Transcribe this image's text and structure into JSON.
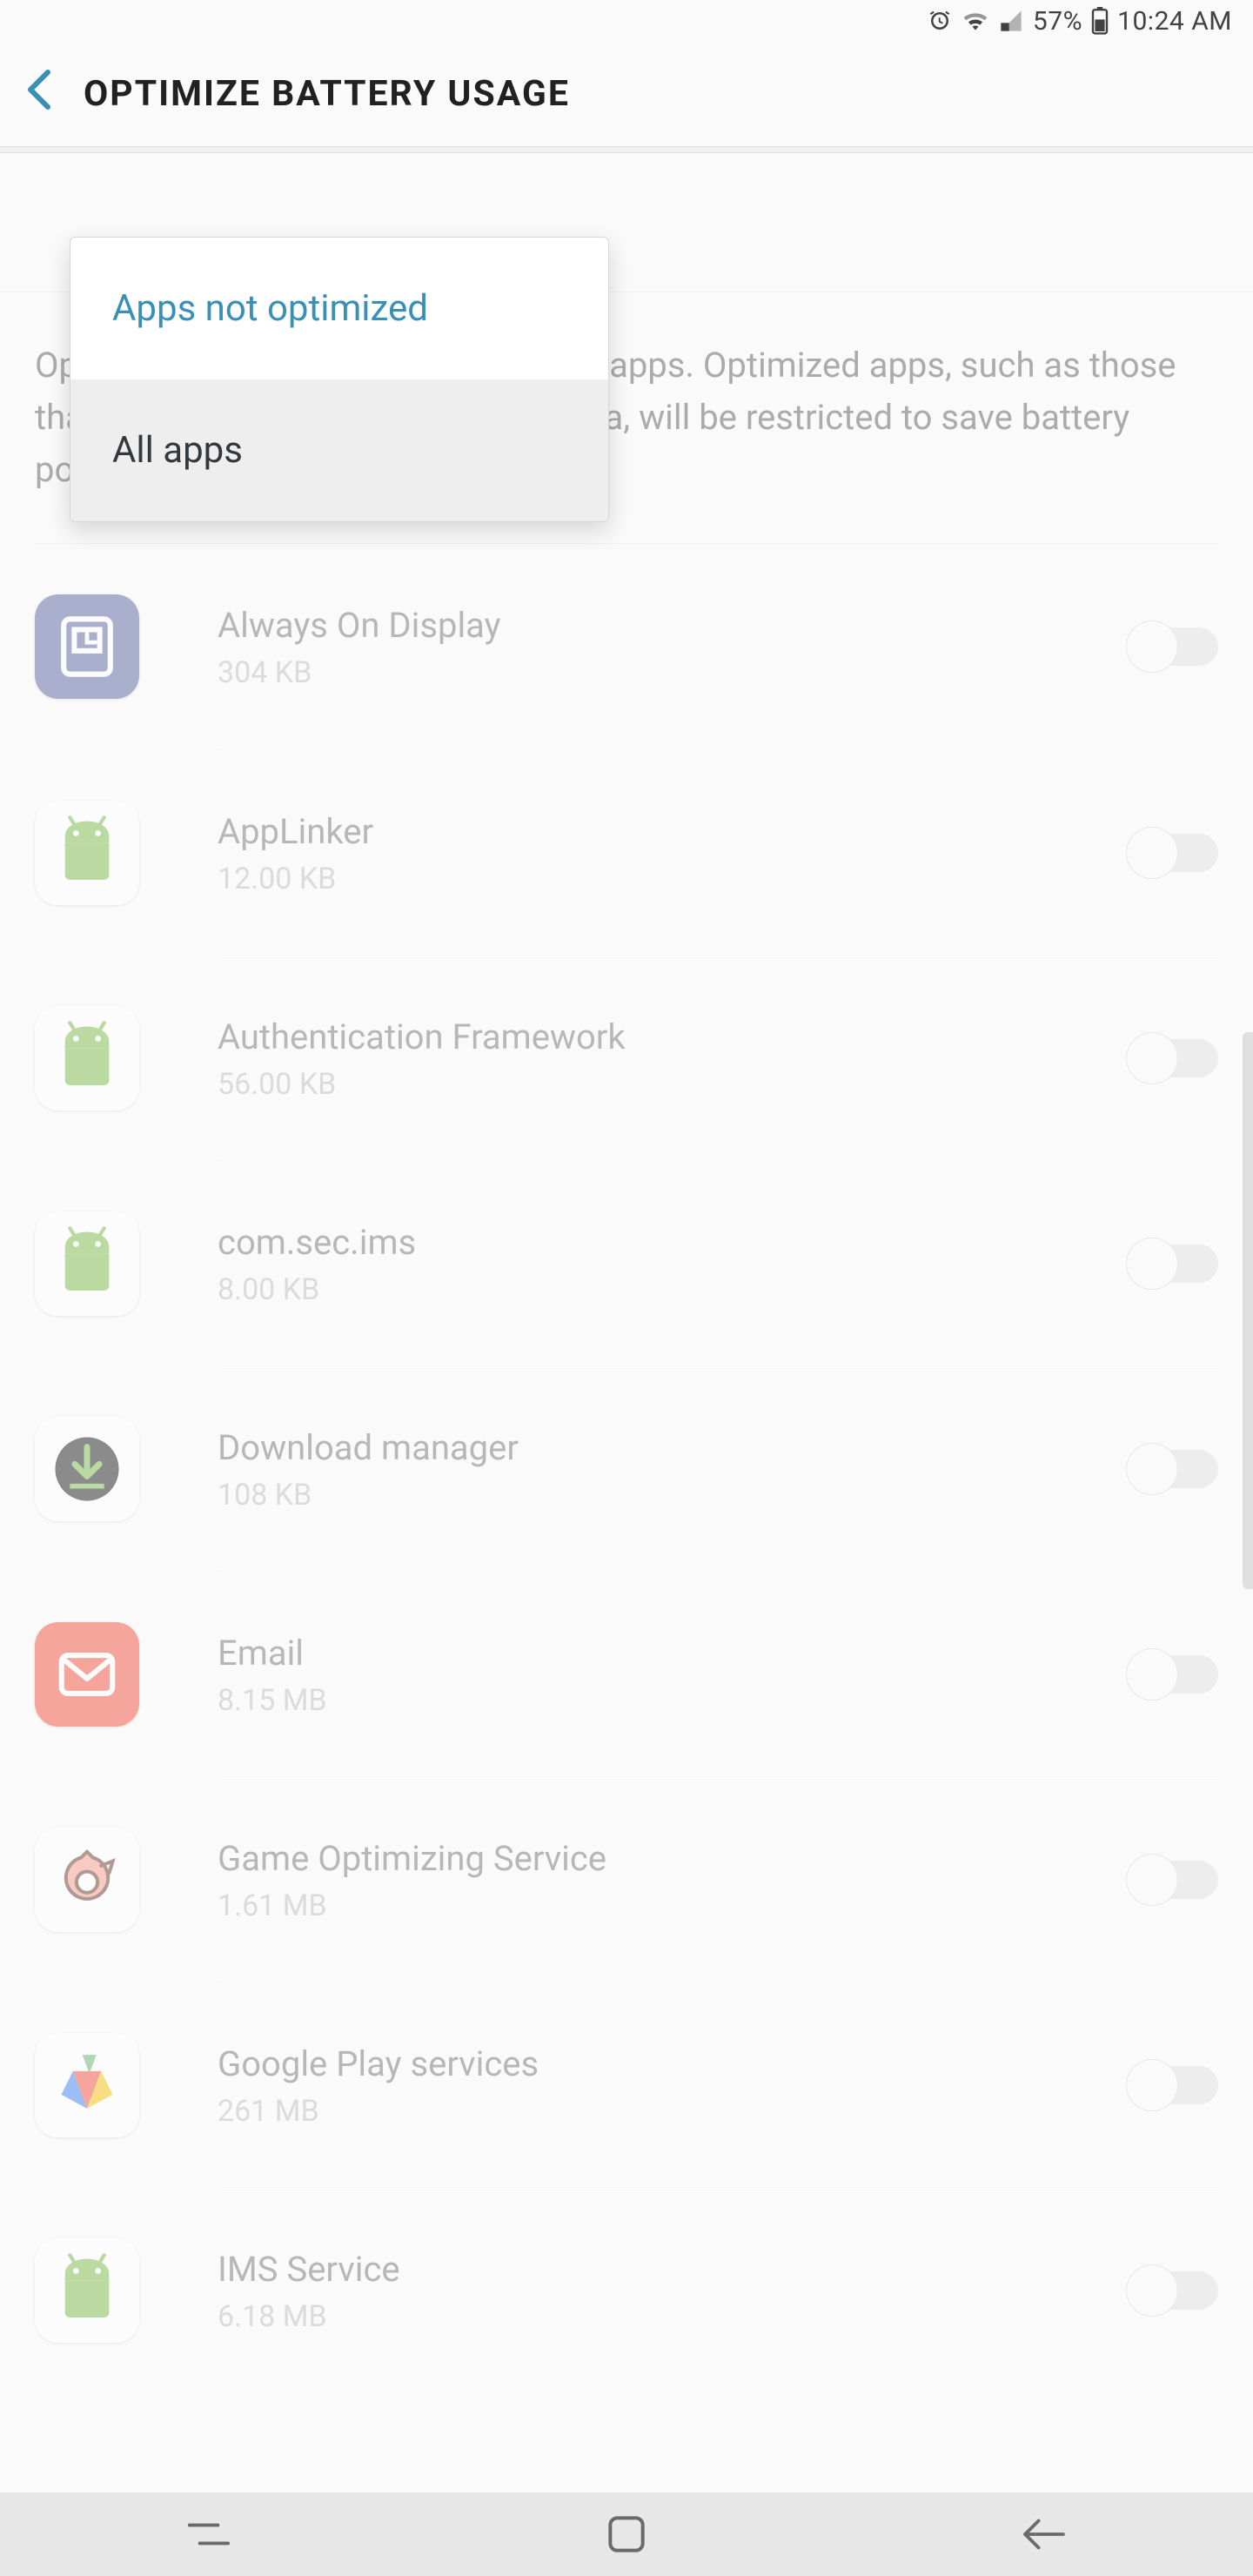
{
  "statusBar": {
    "battery": "57%",
    "time": "10:24 AM"
  },
  "header": {
    "title": "OPTIMIZE BATTERY USAGE"
  },
  "dropdown": {
    "items": [
      {
        "label": "Apps not optimized",
        "selected": true
      },
      {
        "label": "All apps",
        "selected": false,
        "highlight": true
      }
    ]
  },
  "bodyText": "Optimize battery usage for individual apps. Optimized apps, such as those that use mobile networks or sync data, will be restricted to save battery power.",
  "apps": [
    {
      "name": "Always On Display",
      "size": "304 KB",
      "icon": "aod",
      "enabled": false
    },
    {
      "name": "AppLinker",
      "size": "12.00 KB",
      "icon": "android",
      "enabled": false
    },
    {
      "name": "Authentication Framework",
      "size": "56.00 KB",
      "icon": "android",
      "enabled": false
    },
    {
      "name": "com.sec.ims",
      "size": "8.00 KB",
      "icon": "android",
      "enabled": false
    },
    {
      "name": "Download manager",
      "size": "108 KB",
      "icon": "download",
      "enabled": false
    },
    {
      "name": "Email",
      "size": "8.15 MB",
      "icon": "email",
      "enabled": false
    },
    {
      "name": "Game Optimizing Service",
      "size": "1.61 MB",
      "icon": "gos",
      "enabled": false
    },
    {
      "name": "Google Play services",
      "size": "261 MB",
      "icon": "gps",
      "enabled": false
    },
    {
      "name": "IMS Service",
      "size": "6.18 MB",
      "icon": "android",
      "enabled": false
    }
  ]
}
